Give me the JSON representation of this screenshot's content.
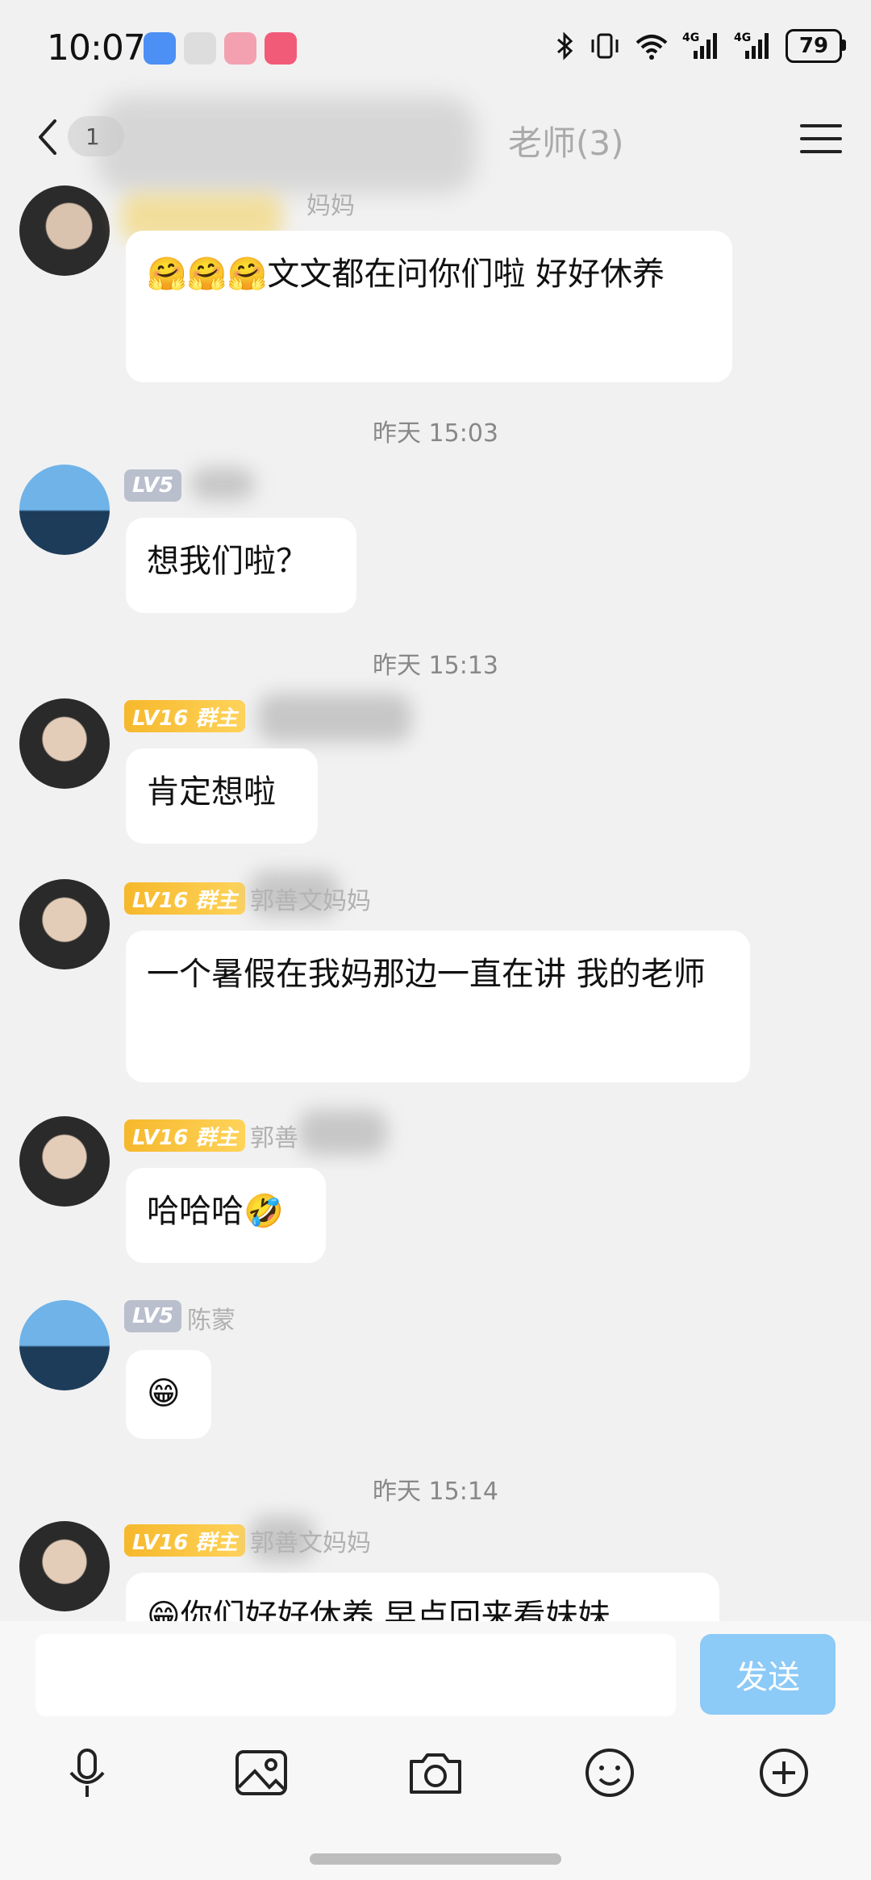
{
  "status_bar": {
    "time": "10:07",
    "battery": "79"
  },
  "nav": {
    "unread_count": "1",
    "title": "老师(3)"
  },
  "messages": [
    {
      "nickname": "妈妈",
      "text": "🤗🤗🤗文文都在问你们啦 好好休养"
    },
    {
      "badge": "LV5",
      "nickname": "",
      "text": "想我们啦？"
    },
    {
      "badge": "LV16 群主",
      "nickname": "",
      "text": "肯定想啦"
    },
    {
      "badge": "LV16 群主",
      "nickname": "郭善文妈妈",
      "text": "一个暑假在我妈那边一直在讲 我的老师"
    },
    {
      "badge": "LV16 群主",
      "nickname": "郭善",
      "text": "哈哈哈🤣"
    },
    {
      "badge": "LV5",
      "nickname": "陈蒙",
      "text": "😁"
    },
    {
      "badge": "LV16 群主",
      "nickname": "郭善文妈妈",
      "text": "😁你们好好休养 早点回来看妹妹"
    }
  ],
  "timestamps": [
    "昨天 15:03",
    "昨天 15:13",
    "昨天 15:14"
  ],
  "input": {
    "value": "",
    "send_label": "发送"
  }
}
